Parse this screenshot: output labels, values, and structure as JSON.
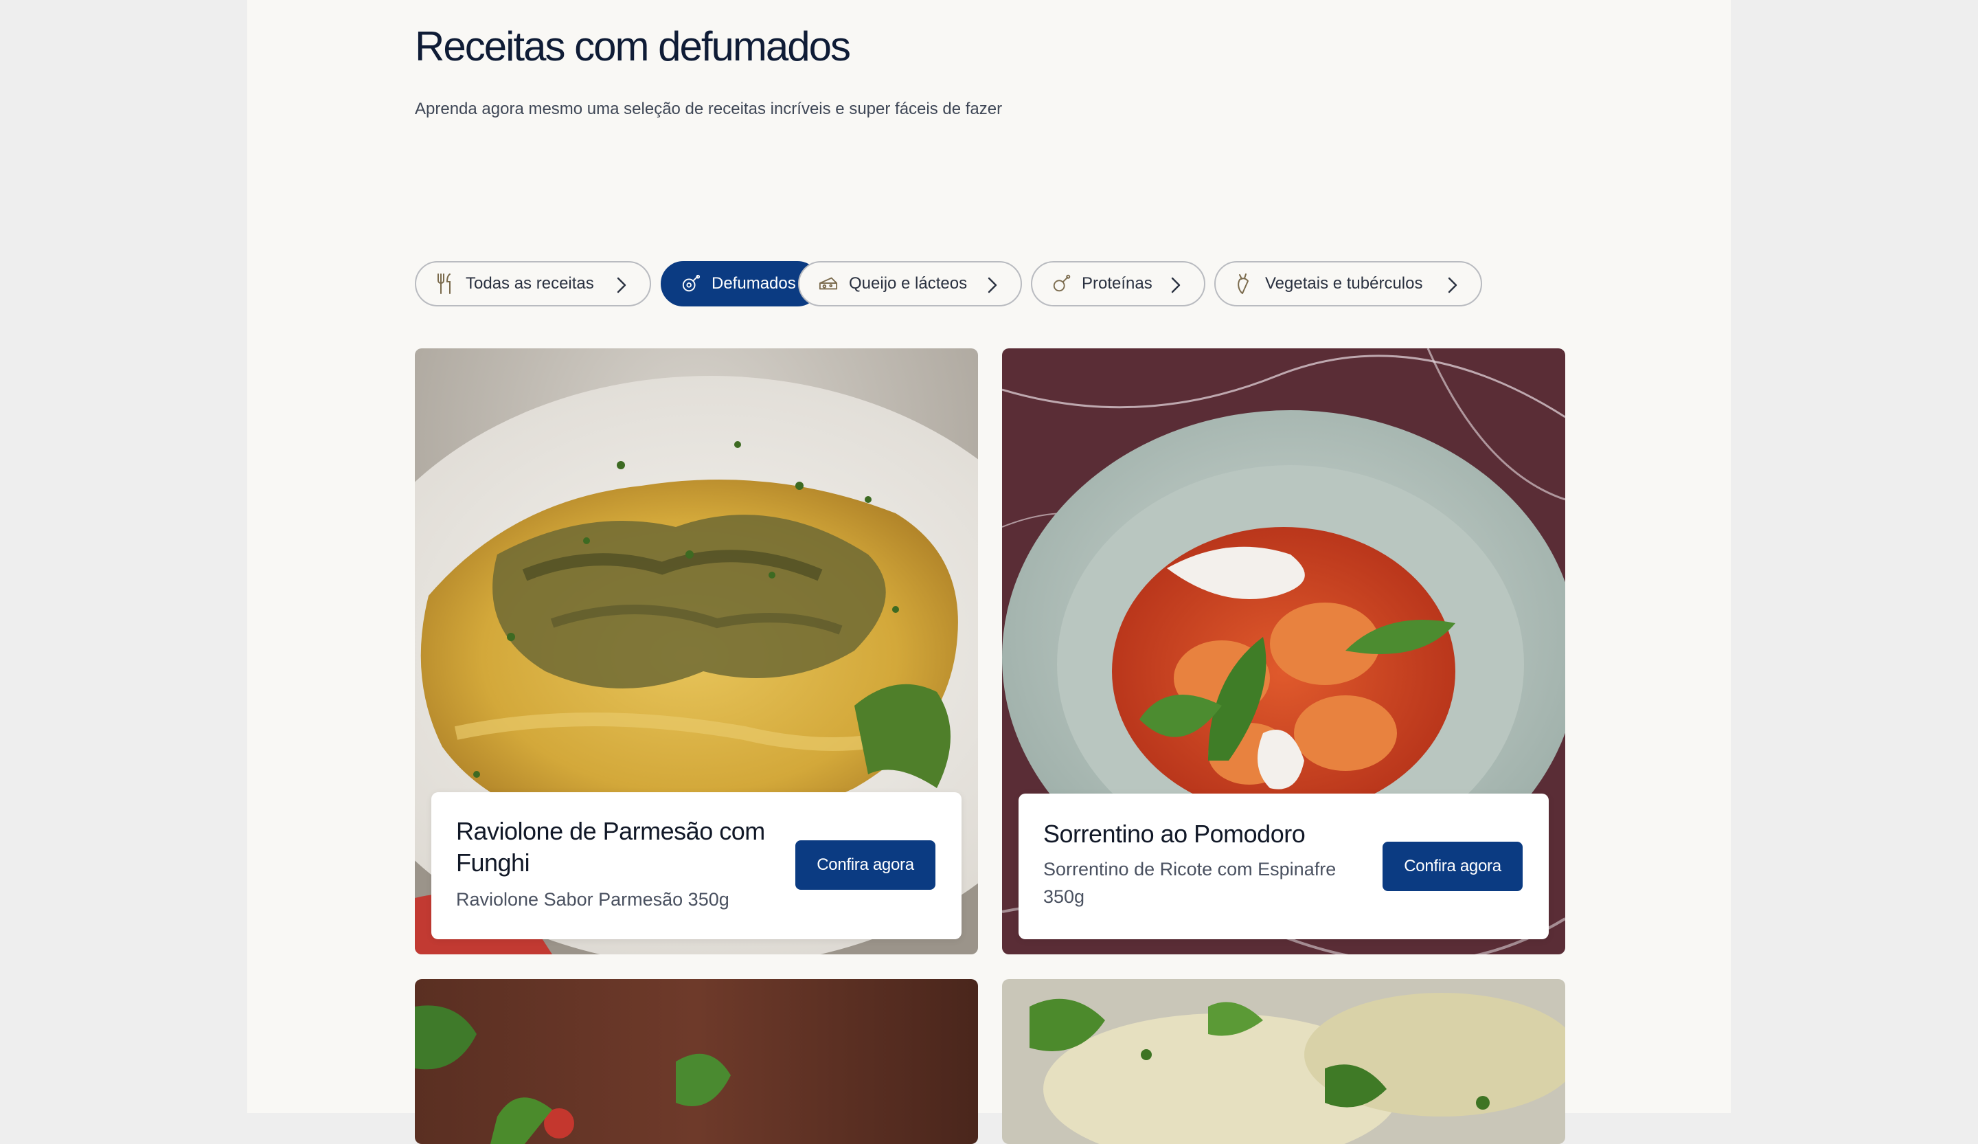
{
  "header": {
    "title": "Receitas com defumados",
    "subtitle": "Aprenda agora mesmo uma seleção de receitas incríveis e super fáceis de fazer"
  },
  "filters": [
    {
      "label": "Todas as receitas",
      "icon": "utensils-icon",
      "active": false
    },
    {
      "label": "Defumados",
      "icon": "ham-icon",
      "active": true
    },
    {
      "label": "Queijo e lácteos",
      "icon": "cheese-icon",
      "active": false
    },
    {
      "label": "Proteínas",
      "icon": "drumstick-icon",
      "active": false
    },
    {
      "label": "Vegetais e tubérculos",
      "icon": "carrot-icon",
      "active": false
    }
  ],
  "recipes": [
    {
      "title": "Raviolone de Parmesão com Funghi",
      "title_line1": "Raviolone de Parmesão com",
      "title_line2": "Funghi",
      "product": "Raviolone Sabor Parmesão 350g",
      "cta": "Confira agora"
    },
    {
      "title": "Sorrentino ao Pomodoro",
      "product_line1": "Sorrentino de Ricote com Espinafre",
      "product_line2": "350g",
      "cta": "Confira agora"
    }
  ],
  "colors": {
    "primary": "#0b3b82",
    "page_background": "#f9f8f5",
    "outer_background": "#eeeeee",
    "title": "#0f1c36"
  }
}
